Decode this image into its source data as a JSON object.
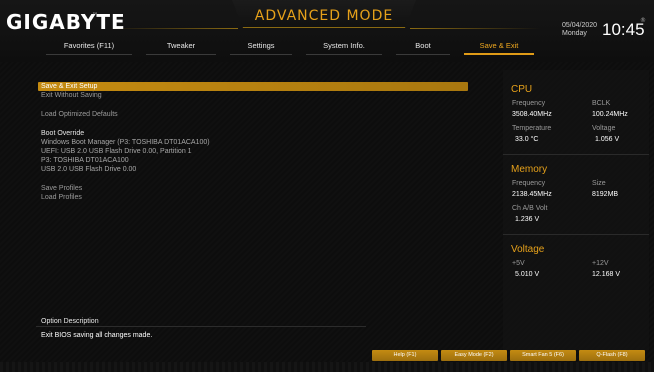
{
  "header": {
    "logo": "GIGABYTE",
    "logo_tm": "™",
    "mode_title": "ADVANCED MODE",
    "date": "05/04/2020",
    "day": "Monday",
    "time": "10:45",
    "reg_mark": "®"
  },
  "tabs": [
    {
      "label": "Favorites (F11)"
    },
    {
      "label": "Tweaker"
    },
    {
      "label": "Settings"
    },
    {
      "label": "System Info."
    },
    {
      "label": "Boot"
    },
    {
      "label": "Save & Exit",
      "active": true
    }
  ],
  "menu": {
    "save_exit_setup": "Save & Exit Setup",
    "exit_without_saving": "Exit Without Saving",
    "load_optimized_defaults": "Load Optimized Defaults",
    "boot_override_heading": "Boot Override",
    "boot_items": [
      "Windows Boot Manager (P3: TOSHIBA DT01ACA100)",
      "UEFI: USB 2.0 USB Flash Drive 0.00, Partition 1",
      "P3: TOSHIBA DT01ACA100",
      "USB 2.0 USB Flash Drive 0.00"
    ],
    "save_profiles": "Save Profiles",
    "load_profiles": "Load Profiles"
  },
  "cpu": {
    "title": "CPU",
    "frequency_label": "Frequency",
    "frequency_value": "3508.40MHz",
    "bclk_label": "BCLK",
    "bclk_value": "100.24MHz",
    "temperature_label": "Temperature",
    "temperature_value": "33.0 °C",
    "voltage_label": "Voltage",
    "voltage_value": "1.056 V"
  },
  "memory": {
    "title": "Memory",
    "frequency_label": "Frequency",
    "frequency_value": "2138.45MHz",
    "size_label": "Size",
    "size_value": "8192MB",
    "chab_label": "Ch A/B Volt",
    "chab_value": "1.236 V"
  },
  "voltage": {
    "title": "Voltage",
    "v5_label": "+5V",
    "v5_value": "5.010 V",
    "v12_label": "+12V",
    "v12_value": "12.168 V"
  },
  "description": {
    "title": "Option Description",
    "text": "Exit BIOS saving all changes made."
  },
  "footer": {
    "help": "Help (F1)",
    "easy_mode": "Easy Mode (F2)",
    "smart_fan": "Smart Fan 5 (F6)",
    "qflash": "Q-Flash (F8)"
  },
  "colors": {
    "accent": "#e6a11a",
    "selected_bg": "#c58b10",
    "background": "#0d0d0d"
  }
}
